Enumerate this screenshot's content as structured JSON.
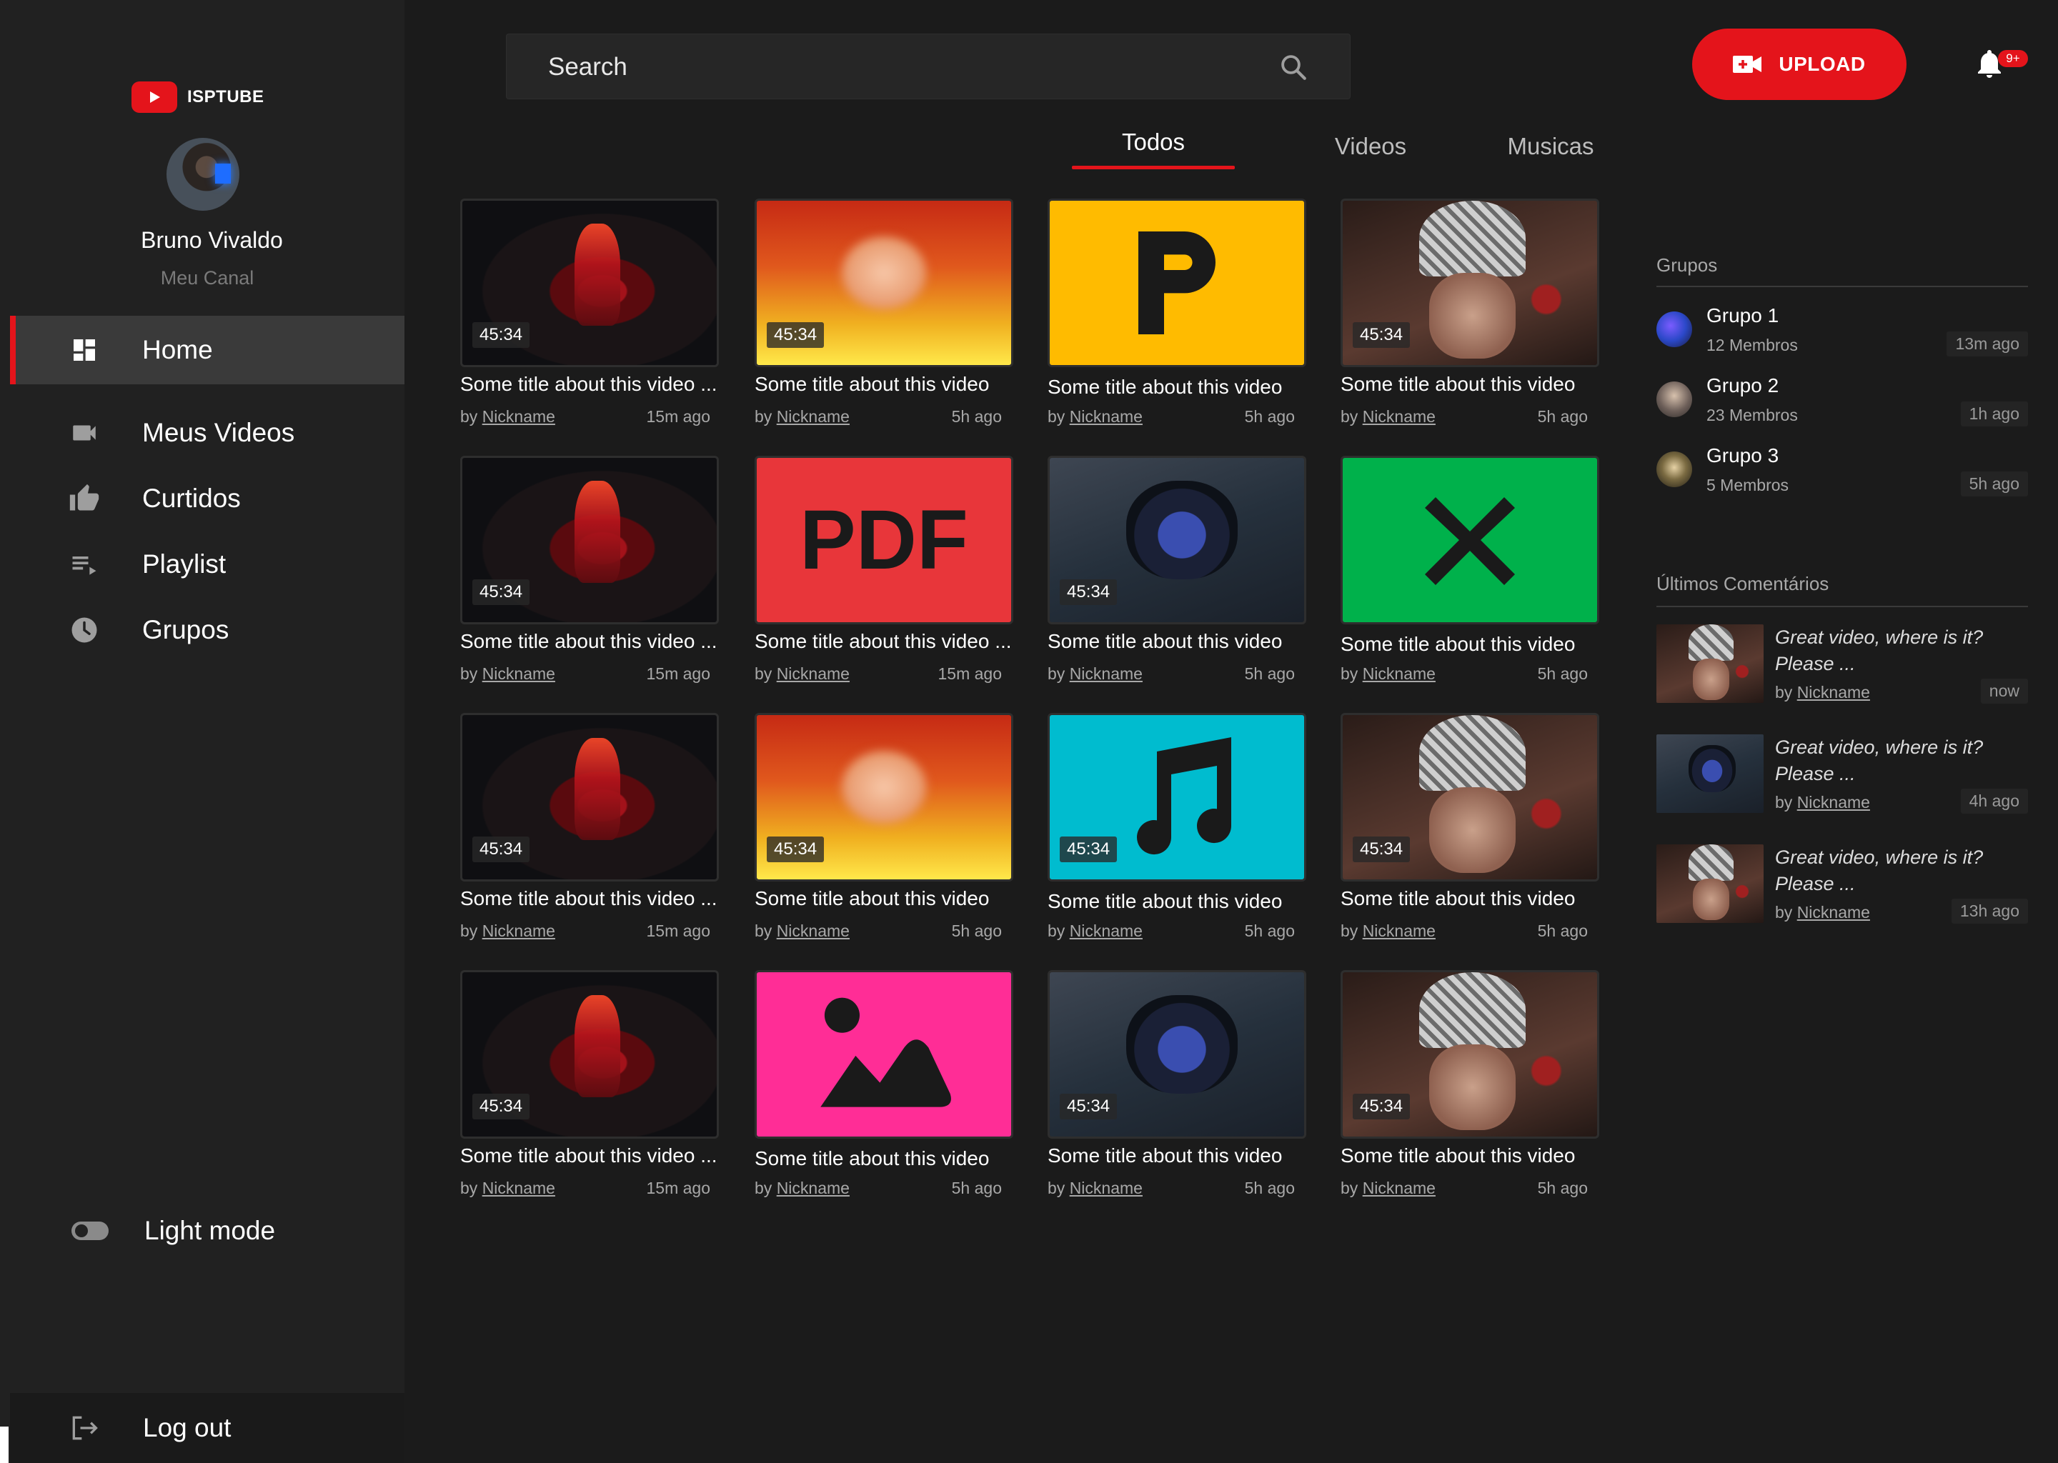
{
  "app": {
    "brand": "ISPTUBE"
  },
  "profile": {
    "name": "Bruno Vivaldo",
    "channel_label": "Meu Canal"
  },
  "sidebar": {
    "items": [
      {
        "label": "Home",
        "icon": "dashboard-icon",
        "active": true
      },
      {
        "label": "Meus Videos",
        "icon": "video-camera-icon",
        "active": false
      },
      {
        "label": "Curtidos",
        "icon": "thumbs-up-icon",
        "active": false
      },
      {
        "label": "Playlist",
        "icon": "playlist-icon",
        "active": false
      },
      {
        "label": "Grupos",
        "icon": "clock-icon",
        "active": false
      }
    ],
    "light_mode_label": "Light mode",
    "logout_label": "Log out"
  },
  "header": {
    "search_placeholder": "Search",
    "upload_label": "UPLOAD",
    "notification_badge": "9+"
  },
  "tabs": [
    {
      "label": "Todos",
      "active": true
    },
    {
      "label": "Videos",
      "active": false
    },
    {
      "label": "Musicas",
      "active": false
    }
  ],
  "videos": [
    {
      "thumb": "red-figure",
      "duration": "45:34",
      "title": "Some title about this video ...",
      "author": "Nickname",
      "ago": "15m ago"
    },
    {
      "thumb": "blur",
      "duration": "45:34",
      "title": "Some title about this video",
      "author": "Nickname",
      "ago": "5h ago"
    },
    {
      "thumb": "p-icon",
      "duration": "",
      "title": "Some title about this video",
      "author": "Nickname",
      "ago": "5h ago"
    },
    {
      "thumb": "hat",
      "duration": "45:34",
      "title": "Some title about this video",
      "author": "Nickname",
      "ago": "5h ago"
    },
    {
      "thumb": "red-figure",
      "duration": "45:34",
      "title": "Some title about this video ...",
      "author": "Nickname",
      "ago": "15m ago"
    },
    {
      "thumb": "pdf-icon",
      "duration": "",
      "title": "Some title about this video ...",
      "author": "Nickname",
      "ago": "15m ago"
    },
    {
      "thumb": "helmet",
      "duration": "45:34",
      "title": "Some title about this video",
      "author": "Nickname",
      "ago": "5h ago"
    },
    {
      "thumb": "x-icon",
      "duration": "",
      "title": "Some title about this video",
      "author": "Nickname",
      "ago": "5h ago"
    },
    {
      "thumb": "red-figure",
      "duration": "45:34",
      "title": "Some title about this video ...",
      "author": "Nickname",
      "ago": "15m ago"
    },
    {
      "thumb": "blur",
      "duration": "45:34",
      "title": "Some title about this video",
      "author": "Nickname",
      "ago": "5h ago"
    },
    {
      "thumb": "music-icon",
      "duration": "45:34",
      "title": "Some title about this video",
      "author": "Nickname",
      "ago": "5h ago"
    },
    {
      "thumb": "hat",
      "duration": "45:34",
      "title": "Some title about this video",
      "author": "Nickname",
      "ago": "5h ago"
    },
    {
      "thumb": "red-figure",
      "duration": "45:34",
      "title": "Some title about this video ...",
      "author": "Nickname",
      "ago": "15m ago"
    },
    {
      "thumb": "image-icon",
      "duration": "",
      "title": "Some title about this video",
      "author": "Nickname",
      "ago": "5h ago"
    },
    {
      "thumb": "helmet",
      "duration": "45:34",
      "title": "Some title about this video",
      "author": "Nickname",
      "ago": "5h ago"
    },
    {
      "thumb": "hat",
      "duration": "45:34",
      "title": "Some title about this video",
      "author": "Nickname",
      "ago": "5h ago"
    }
  ],
  "video_by_prefix": "by",
  "groups": {
    "title": "Grupos",
    "items": [
      {
        "name": "Grupo 1",
        "members": "12 Membros",
        "ago": "13m ago"
      },
      {
        "name": "Grupo 2",
        "members": "23 Membros",
        "ago": "1h ago"
      },
      {
        "name": "Grupo 3",
        "members": "5 Membros",
        "ago": "5h ago"
      }
    ]
  },
  "comments": {
    "title": "Últimos Comentários",
    "items": [
      {
        "thumb": "hat",
        "text": "Great video, where is it? Please ...",
        "author": "Nickname",
        "ago": "now"
      },
      {
        "thumb": "helmet",
        "text": "Great video, where is it? Please ...",
        "author": "Nickname",
        "ago": "4h ago"
      },
      {
        "thumb": "hat",
        "text": "Great video, where is it? Please ...",
        "author": "Nickname",
        "ago": "13h ago"
      }
    ]
  },
  "colors": {
    "accent": "#e4141b",
    "background": "#1b1b1b",
    "sidebar": "#212121",
    "p_icon_bg": "#ffbb00",
    "pdf_icon_bg": "#e8363a",
    "x_icon_bg": "#00b14b",
    "music_icon_bg": "#00bccf",
    "image_icon_bg": "#ff2d96"
  }
}
